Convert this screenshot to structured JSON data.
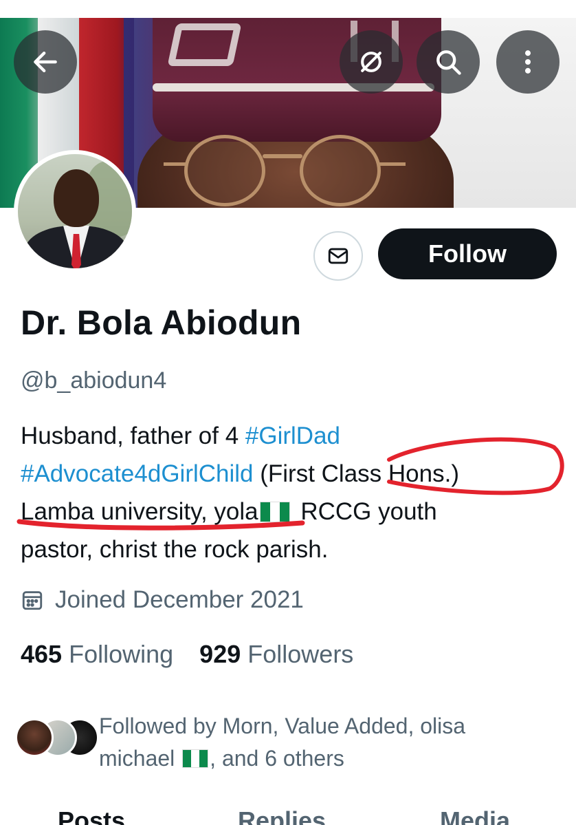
{
  "header": {
    "back_icon": "arrow-left-icon",
    "grok_icon": "grok-icon",
    "search_icon": "search-icon",
    "more_icon": "more-vertical-icon"
  },
  "profile": {
    "display_name": "Dr. Bola Abiodun",
    "handle": "@b_abiodun4",
    "follow_label": "Follow",
    "message_icon": "mail-icon",
    "bio": {
      "line1_text": "Husband, father of 4 ",
      "tag1": "#GirlDad",
      "tag2": "#Advocate4dGirlChild",
      "line2_text": " (First Class Hons.)",
      "line3_text": "Lamba university, yola",
      "line3_after_flag": " RCCG youth",
      "line4_text": "pastor, christ the rock parish."
    },
    "joined": "Joined December 2021",
    "following_count": "465",
    "following_label": "Following",
    "followers_count": "929",
    "followers_label": "Followers",
    "followed_by_part1": "Followed by Morn, Value Added, olisa",
    "followed_by_part2": "michael",
    "followed_by_part3": ", and 6 others"
  },
  "tabs": [
    "Posts",
    "Replies",
    "Media"
  ],
  "colors": {
    "accent_link": "#1d8fd0",
    "text_primary": "#0f1419",
    "text_secondary": "#536471",
    "follow_bg": "#0f1419",
    "annotation": "#e3232d"
  }
}
